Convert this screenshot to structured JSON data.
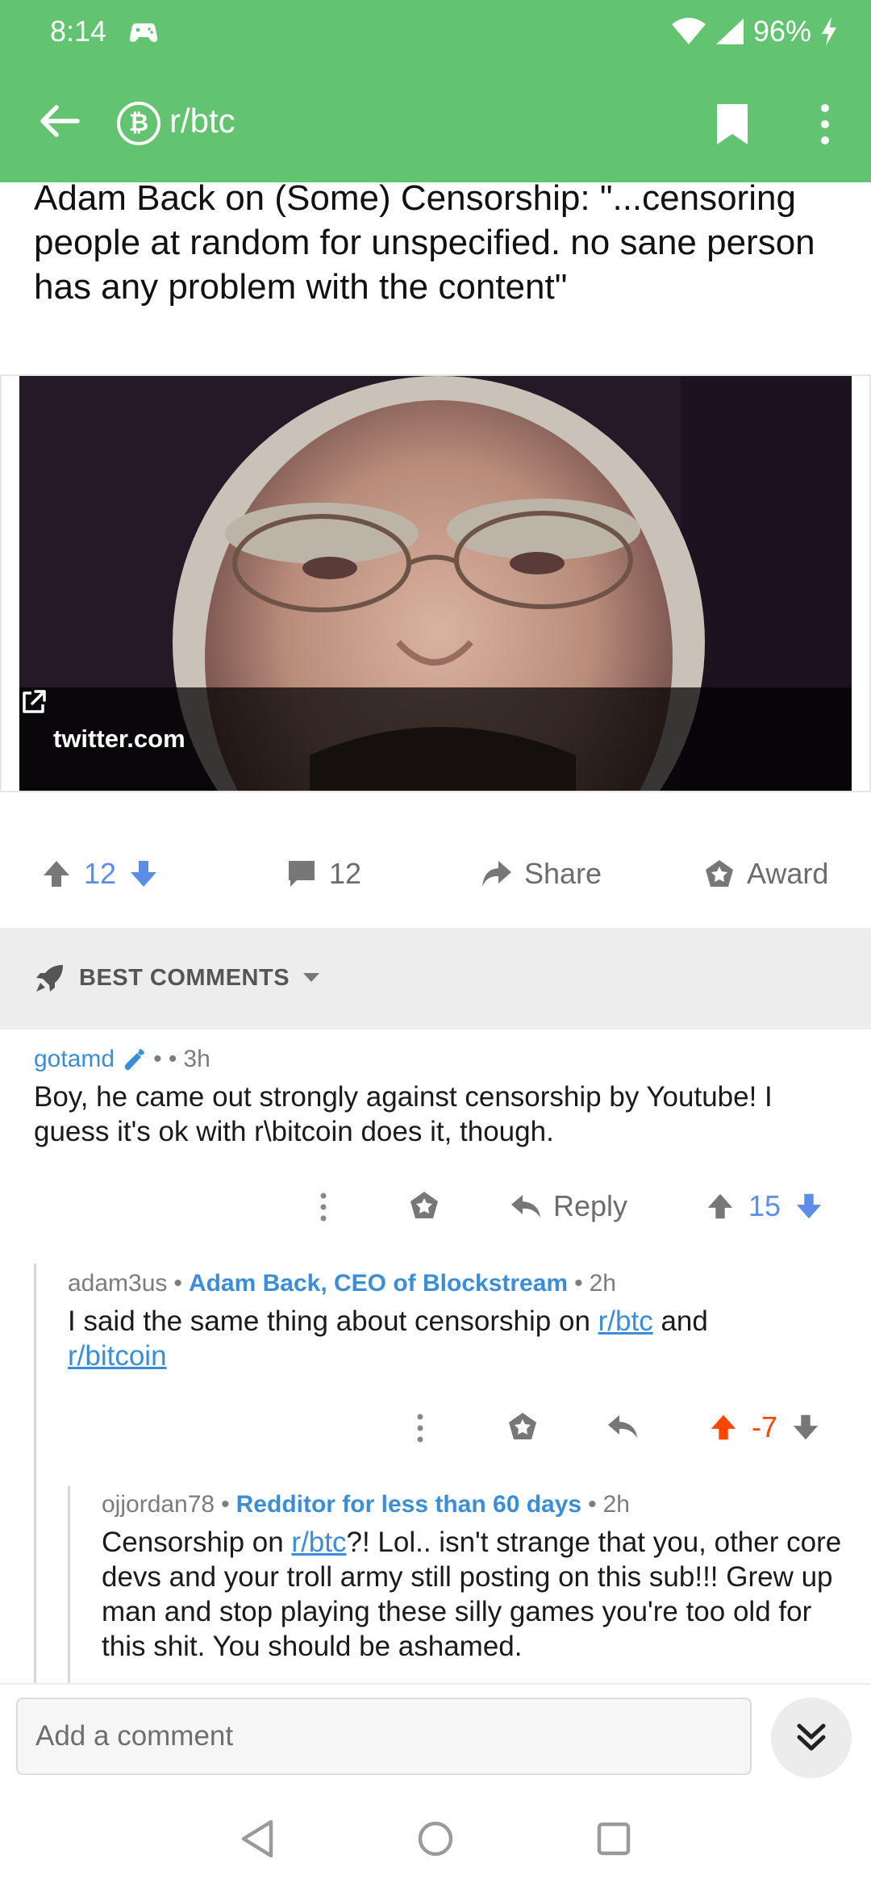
{
  "status_bar": {
    "time": "8:14",
    "battery": "96%"
  },
  "app_bar": {
    "subreddit": "r/btc"
  },
  "post": {
    "title": "Adam Back on (Some) Censorship: \"...censoring people at random for unspecified. no sane person has any problem with the content\"",
    "link_domain": "twitter.com",
    "votes": "12",
    "comments_count": "12",
    "share_label": "Share",
    "award_label": "Award"
  },
  "sort": {
    "label": "BEST COMMENTS"
  },
  "comments": [
    {
      "author": "gotamd",
      "time": "3h",
      "body": "Boy, he came out strongly against censorship by Youtube!  I guess it's ok with r\\bitcoin does it, though.",
      "reply_label": "Reply",
      "score": "15"
    },
    {
      "author": "adam3us",
      "flair": "Adam Back, CEO of Blockstream",
      "time": "2h",
      "body_prefix": "I said the same thing about censorship on ",
      "link1": "r/btc",
      "body_mid": " and ",
      "link2": "r/bitcoin",
      "score": "-7",
      "score_color": "#ff4500"
    },
    {
      "author": "ojjordan78",
      "flair": "Redditor for less than 60 days",
      "time": "2h",
      "body_prefix": "Censorship on ",
      "link1": "r/btc",
      "body_suffix": "?! Lol.. isn't strange that you, other core devs and your troll army still posting on this sub!!! Grew up man and stop playing these silly games you're too old for this shit. You should be ashamed."
    }
  ],
  "composer": {
    "placeholder": "Add a comment"
  },
  "colors": {
    "brand": "#62c370",
    "link": "#3a8ed9",
    "vote": "#5b8de9",
    "downvoted": "#ff4500"
  },
  "icons": [
    "back-arrow-icon",
    "bitcoin-icon",
    "bookmark-icon",
    "more-vert-icon",
    "upvote-icon",
    "downvote-icon",
    "comment-icon",
    "share-icon",
    "award-icon",
    "rocket-icon",
    "reply-icon"
  ]
}
